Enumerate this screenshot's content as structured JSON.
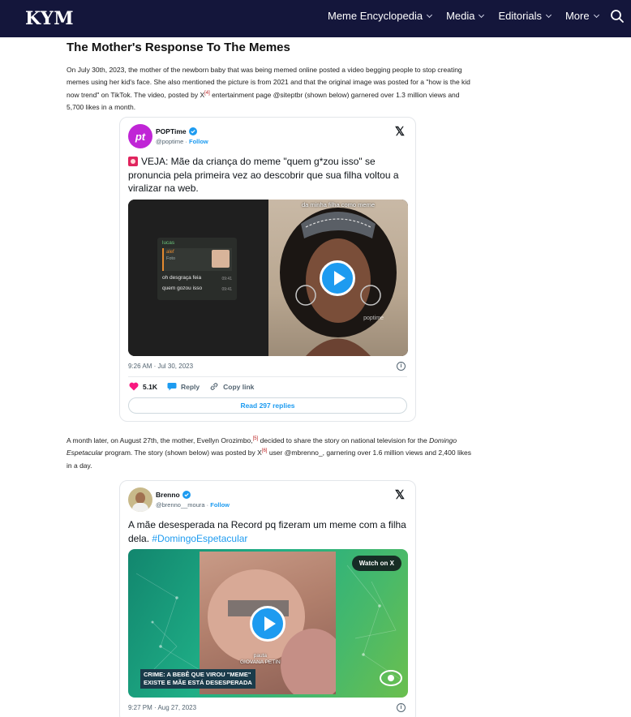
{
  "nav": {
    "logo": "KYM",
    "items": [
      {
        "label": "Meme Encyclopedia"
      },
      {
        "label": "Media"
      },
      {
        "label": "Editorials"
      },
      {
        "label": "More"
      }
    ]
  },
  "article": {
    "heading": "The Mother's Response To The Memes",
    "para1": {
      "text_a": "On July 30th, 2023, the mother of the newborn baby that was being memed online posted a video begging people to stop creating memes using her kid's face. She also mentioned the picture is from 2021 and that the original image was posted for a \"how is the kid now trend\" on TikTok. The video, posted by X",
      "ref": "[4]",
      "text_b": " entertainment page @siteptbr (shown below) garnered over 1.3 million views and 5,700 likes in a month."
    },
    "para2": {
      "text_a": "A month later, on August 27th, the mother, Evellyn Orozimbo,",
      "ref1": "[5]",
      "text_b": " decided to share the story on national television for the ",
      "program": "Domingo Espetacular",
      "text_c": " program. The story (shown below) was posted by X",
      "ref2": "[6]",
      "text_d": " user @mbrenno_, garnering over 1.6 million views and 2,400 likes in a day."
    }
  },
  "tweet1": {
    "avatar_text": "pt",
    "display_name": "POPTime",
    "handle": "@poptime",
    "separator": "·",
    "follow": "Follow",
    "text": "VEJA: Mãe da criança do meme \"quem g*zou isso\" se pronuncia pela primeira vez ao descobrir que sua filha voltou a viralizar na web.",
    "chat": {
      "sender": "lucas",
      "quoted_name": "alef",
      "quoted_type": "Foto",
      "line1": "oh desgraça feia",
      "line1_time": "09:41",
      "line2": "quem gozou isso",
      "line2_time": "09:41"
    },
    "overlay_text": "da minha filha como meme",
    "watermark": "poptime",
    "timestamp": "9:26 AM · Jul 30, 2023",
    "likes": "5.1K",
    "reply_label": "Reply",
    "copy_label": "Copy link",
    "read_replies": "Read 297 replies",
    "info_glyph": "i"
  },
  "tweet2": {
    "display_name": "Brenno",
    "handle": "@brenno__moura",
    "separator": "·",
    "follow": "Follow",
    "text": "A mãe desesperada na Record pq fizeram um meme com a filha dela. ",
    "hashtag": "#DomingoEspetacular",
    "watch_label": "Watch on X",
    "caption_line1": "pauta",
    "caption_line2": "GIOVANA PETIN",
    "banner_line1": "CRIME: A BEBÊ QUE VIROU \"MEME\"",
    "banner_line2": "EXISTE E MÃE ESTÁ DESESPERADA",
    "timestamp": "9:27 PM · Aug 27, 2023",
    "info_glyph": "i"
  },
  "colors": {
    "nav_bg": "#14163b",
    "link_blue": "#1d9bf0",
    "like_pink": "#f91880"
  }
}
